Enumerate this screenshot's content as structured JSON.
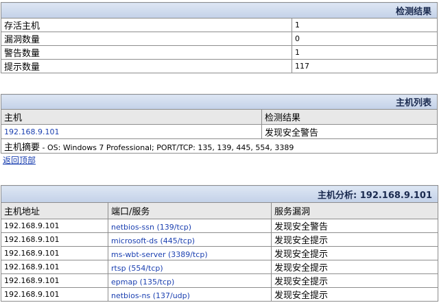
{
  "summary": {
    "title": "检测结果",
    "rows": [
      {
        "label": "存活主机",
        "value": "1"
      },
      {
        "label": "漏洞数量",
        "value": "0"
      },
      {
        "label": "警告数量",
        "value": "1"
      },
      {
        "label": "提示数量",
        "value": "117"
      }
    ]
  },
  "hostlist": {
    "title": "主机列表",
    "col_host": "主机",
    "col_result": "检测结果",
    "host_ip": "192.168.9.101",
    "host_result": "发现安全警告",
    "summary_label": "主机摘要",
    "summary_text": " - OS: Windows 7 Professional; PORT/TCP: 135, 139, 445, 554, 3389"
  },
  "back_link": "返回顶部",
  "analysis": {
    "title": "主机分析: 192.168.9.101",
    "col_addr": "主机地址",
    "col_port": "端口/服务",
    "col_vuln": "服务漏洞",
    "rows": [
      {
        "addr": "192.168.9.101",
        "service": "netbios-ssn (139/tcp)",
        "vuln": "发现安全警告"
      },
      {
        "addr": "192.168.9.101",
        "service": "microsoft-ds (445/tcp)",
        "vuln": "发现安全提示"
      },
      {
        "addr": "192.168.9.101",
        "service": "ms-wbt-server (3389/tcp)",
        "vuln": "发现安全提示"
      },
      {
        "addr": "192.168.9.101",
        "service": "rtsp (554/tcp)",
        "vuln": "发现安全提示"
      },
      {
        "addr": "192.168.9.101",
        "service": "epmap (135/tcp)",
        "vuln": "发现安全提示"
      },
      {
        "addr": "192.168.9.101",
        "service": "netbios-ns (137/udp)",
        "vuln": "发现安全提示"
      }
    ]
  }
}
